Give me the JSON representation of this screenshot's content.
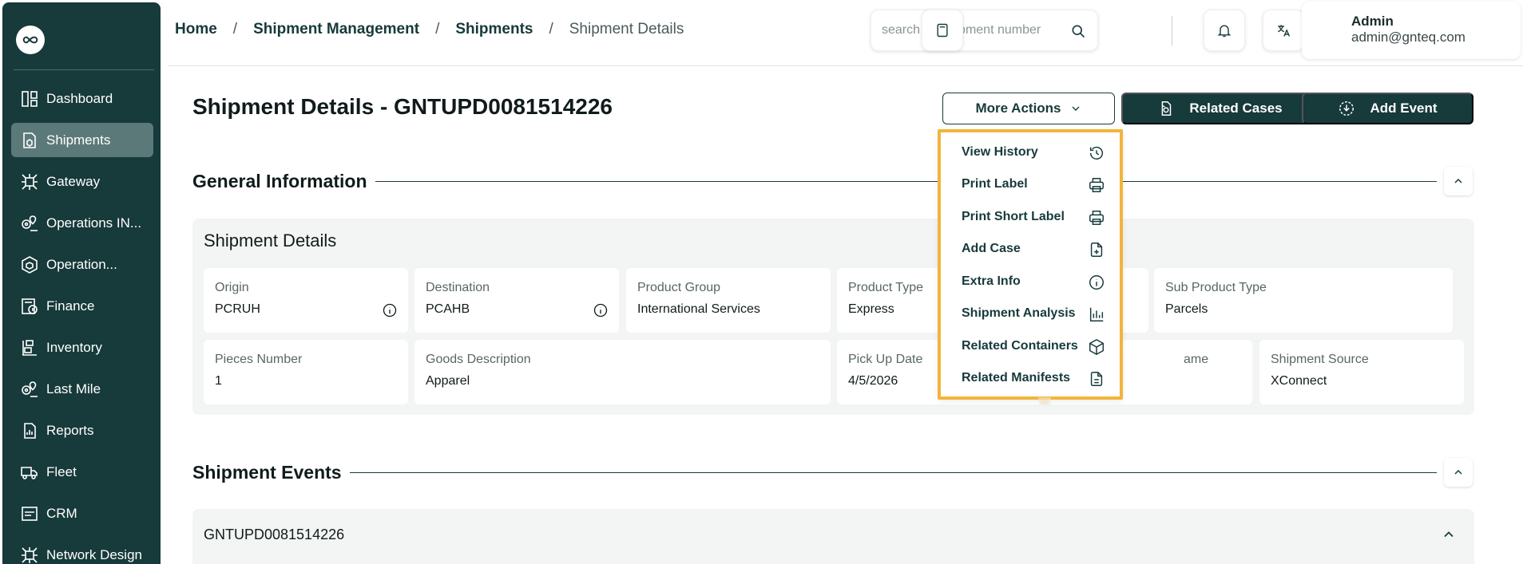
{
  "sidebar": {
    "items": [
      {
        "label": "Dashboard",
        "icon": "dashboard-icon",
        "active": false
      },
      {
        "label": "Shipments",
        "icon": "shipments-icon",
        "active": true
      },
      {
        "label": "Gateway",
        "icon": "gateway-icon",
        "active": false
      },
      {
        "label": "Operations IN...",
        "icon": "operations-in-icon",
        "active": false
      },
      {
        "label": "Operation...",
        "icon": "operation-icon",
        "active": false
      },
      {
        "label": "Finance",
        "icon": "finance-icon",
        "active": false
      },
      {
        "label": "Inventory",
        "icon": "inventory-icon",
        "active": false
      },
      {
        "label": "Last Mile",
        "icon": "last-mile-icon",
        "active": false
      },
      {
        "label": "Reports",
        "icon": "reports-icon",
        "active": false
      },
      {
        "label": "Fleet",
        "icon": "fleet-icon",
        "active": false
      },
      {
        "label": "CRM",
        "icon": "crm-icon",
        "active": false
      },
      {
        "label": "Network Design",
        "icon": "network-design-icon",
        "active": false
      }
    ]
  },
  "header": {
    "breadcrumb": [
      "Home",
      "Shipment Management",
      "Shipments",
      "Shipment Details"
    ],
    "breadcrumb_sep": "/",
    "search_placeholder": "search for shipment number",
    "user": {
      "name": "Admin",
      "email": "admin@gnteq.com"
    }
  },
  "page": {
    "title": "Shipment Details - GNTUPD0081514226",
    "more_actions_label": "More Actions",
    "related_cases_label": "Related Cases",
    "add_event_label": "Add Event"
  },
  "general_info": {
    "section_title": "General Information",
    "card_title": "Shipment Details",
    "fields": {
      "origin": {
        "label": "Origin",
        "value": "PCRUH"
      },
      "destination": {
        "label": "Destination",
        "value": "PCAHB"
      },
      "product_group": {
        "label": "Product Group",
        "value": "International Services"
      },
      "product_type": {
        "label": "Product Type",
        "value": "Express"
      },
      "sub_product_type": {
        "label": "Sub Product Type",
        "value": "Parcels"
      },
      "pieces_number": {
        "label": "Pieces Number",
        "value": "1"
      },
      "goods_description": {
        "label": "Goods Description",
        "value": "Apparel"
      },
      "pick_up_date": {
        "label": "Pick Up Date",
        "value": "4/5/2026"
      },
      "hidden_name_label_fragment": {
        "label": "ame",
        "value": ""
      },
      "shipment_source": {
        "label": "Shipment Source",
        "value": "XConnect"
      }
    }
  },
  "events": {
    "section_title": "Shipment Events",
    "first_event_id": "GNTUPD0081514226"
  },
  "dropdown": {
    "items": [
      {
        "label": "View History",
        "icon": "history-icon"
      },
      {
        "label": "Print Label",
        "icon": "printer-icon"
      },
      {
        "label": "Print Short Label",
        "icon": "printer-icon"
      },
      {
        "label": "Add Case",
        "icon": "add-case-icon"
      },
      {
        "label": "Extra Info",
        "icon": "info-icon"
      },
      {
        "label": "Shipment Analysis",
        "icon": "analysis-chart-icon"
      },
      {
        "label": "Related Containers",
        "icon": "container-box-icon"
      },
      {
        "label": "Related Manifests",
        "icon": "manifest-document-icon"
      }
    ],
    "highlight_color": "#f2b43a"
  },
  "colors": {
    "brand_dark": "#173a3b",
    "sidebar_active": "#5c7979",
    "card_bg": "#f3f4f4"
  }
}
